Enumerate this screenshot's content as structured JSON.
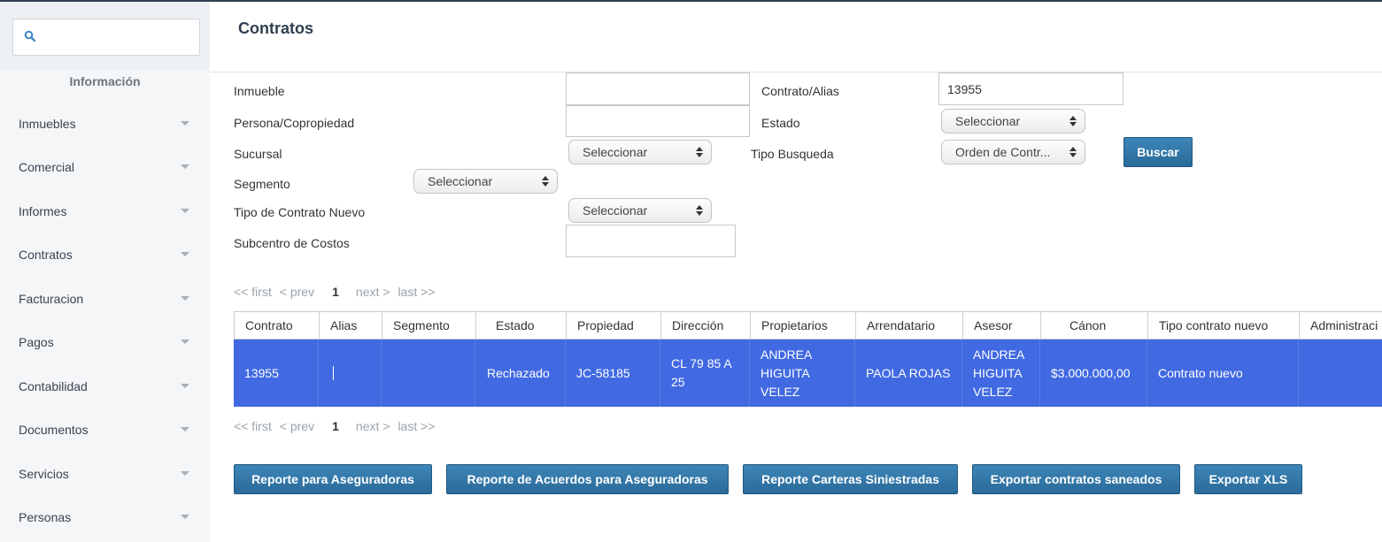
{
  "sidebar": {
    "search_placeholder": "",
    "section_title": "Información",
    "items": [
      {
        "label": "Inmuebles"
      },
      {
        "label": "Comercial"
      },
      {
        "label": "Informes"
      },
      {
        "label": "Contratos"
      },
      {
        "label": "Facturacion"
      },
      {
        "label": "Pagos"
      },
      {
        "label": "Contabilidad"
      },
      {
        "label": "Documentos"
      },
      {
        "label": "Servicios"
      },
      {
        "label": "Personas"
      }
    ]
  },
  "page": {
    "title": "Contratos"
  },
  "filters": {
    "inmueble": {
      "label": "Inmueble",
      "value": ""
    },
    "contrato_alias": {
      "label": "Contrato/Alias",
      "value": "13955"
    },
    "persona": {
      "label": "Persona/Copropiedad",
      "value": ""
    },
    "estado": {
      "label": "Estado",
      "value": "Seleccionar"
    },
    "sucursal": {
      "label": "Sucursal",
      "value": "Seleccionar"
    },
    "tipo_busqueda": {
      "label": "Tipo Busqueda",
      "value": "Orden de Contr..."
    },
    "segmento": {
      "label": "Segmento",
      "value": "Seleccionar"
    },
    "tipo_contrato_nuevo": {
      "label": "Tipo de Contrato Nuevo",
      "value": "Seleccionar"
    },
    "subcentro": {
      "label": "Subcentro de Costos",
      "value": ""
    },
    "buscar_label": "Buscar"
  },
  "pager": {
    "first": "<< first",
    "prev": "< prev",
    "current": "1",
    "next": "next >",
    "last": "last >>"
  },
  "table": {
    "columns": [
      "Contrato",
      "Alias",
      "Segmento",
      "Estado",
      "Propiedad",
      "Dirección",
      "Propietarios",
      "Arrendatario",
      "Asesor",
      "Cánon",
      "Tipo contrato nuevo",
      "Administraci"
    ],
    "rows": [
      {
        "contrato": "13955",
        "alias": "",
        "segmento": "",
        "estado": "Rechazado",
        "propiedad": "JC-58185",
        "direccion": "CL 79 85 A 25",
        "propietarios": "ANDREA HIGUITA VELEZ",
        "arrendatario": "PAOLA ROJAS",
        "asesor": "ANDREA HIGUITA VELEZ",
        "canon": "$3.000.000,00",
        "tipo_contrato_nuevo": "Contrato nuevo",
        "administracion": ""
      }
    ]
  },
  "actions": {
    "reporte_aseguradoras": "Reporte para Aseguradoras",
    "reporte_acuerdos": "Reporte de Acuerdos para Aseguradoras",
    "reporte_carteras": "Reporte Carteras Siniestradas",
    "exportar_saneados": "Exportar contratos saneados",
    "exportar_xls": "Exportar XLS"
  },
  "colors": {
    "accent_button": "#2f74a8",
    "selected_row": "#4169e1",
    "title": "#2f3e4e"
  }
}
